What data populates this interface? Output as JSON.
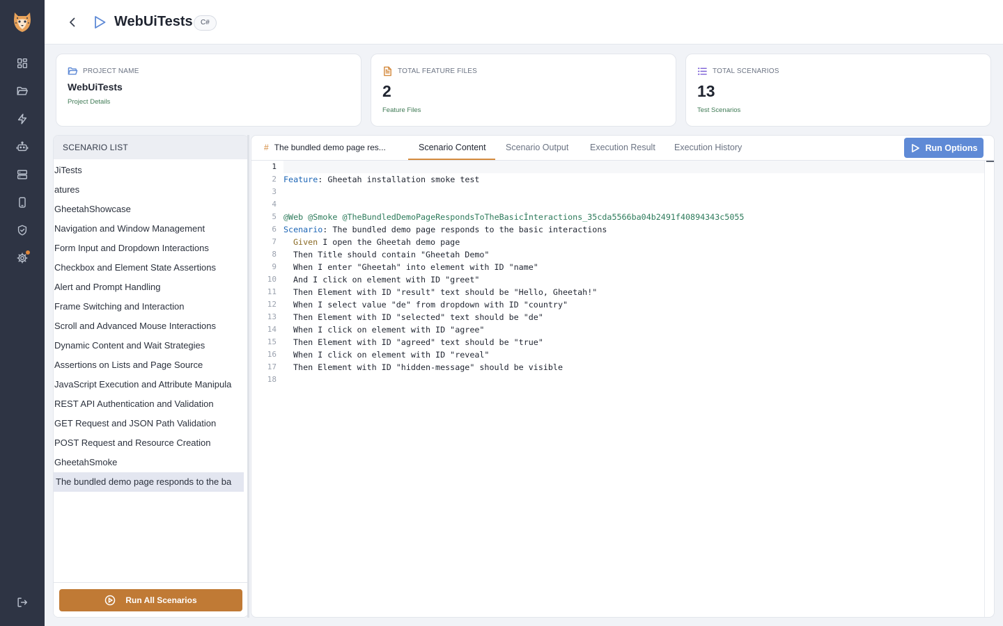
{
  "rail": {
    "items": [
      "dashboard-icon",
      "folder-icon",
      "lightning-icon",
      "robot-icon",
      "server-icon",
      "mobile-icon",
      "shield-icon",
      "gear-icon"
    ],
    "bottom": "logout-icon"
  },
  "header": {
    "title": "WebUiTests",
    "lang_badge": "C#"
  },
  "cards": {
    "project": {
      "label": "PROJECT NAME",
      "value": "WebUiTests",
      "sub": "Project Details"
    },
    "features": {
      "label": "TOTAL FEATURE FILES",
      "value": "2",
      "sub": "Feature Files"
    },
    "scenarios": {
      "label": "TOTAL SCENARIOS",
      "value": "13",
      "sub": "Test Scenarios"
    }
  },
  "scenario_list": {
    "header": "SCENARIO LIST",
    "items": [
      "JiTests",
      "atures",
      "GheetahShowcase",
      "Navigation and Window Management",
      "Form Input and Dropdown Interactions",
      "Checkbox and Element State Assertions",
      "Alert and Prompt Handling",
      "Frame Switching and Interaction",
      "Scroll and Advanced Mouse Interactions",
      "Dynamic Content and Wait Strategies",
      "Assertions on Lists and Page Source",
      "JavaScript Execution and Attribute Manipula",
      "REST API Authentication and Validation",
      "GET Request and JSON Path Validation",
      "POST Request and Resource Creation",
      "GheetahSmoke",
      "The bundled demo page responds to the ba"
    ],
    "run_all_label": "Run All Scenarios"
  },
  "editor": {
    "file_tab": "The bundled demo page res...",
    "tabs": [
      "Scenario Content",
      "Scenario Output",
      "Execution Result",
      "Execution History"
    ],
    "active_tab": "Scenario Content",
    "run_options_label": "Run Options",
    "code": {
      "line_numbers": [
        "1",
        "2",
        "3",
        "4",
        "5",
        "6",
        "7",
        "8",
        "9",
        "10",
        "11",
        "12",
        "13",
        "14",
        "15",
        "16",
        "17",
        "18"
      ],
      "feature_kw": "Feature",
      "feature_text": ": Gheetah installation smoke test",
      "tags_text": "@Web @Smoke @TheBundledDemoPageRespondsToTheBasicİnteractions_35cda5566ba04b2491f40894343c",
      "tags_suffix": "5055",
      "scenario_kw": "Scenario",
      "scenario_text": ": The bundled demo page responds to the basic interactions",
      "given_kw": "Given",
      "given_text": " I open the Gheetah demo page",
      "steps": [
        "Then Title should contain \"Gheetah Demo\"",
        "When I enter \"Gheetah\" into element with ID \"name\"",
        "And I click on element with ID \"greet\"",
        "Then Element with ID \"result\" text should be \"Hello, Gheetah!\"",
        "When I select value \"de\" from dropdown with ID \"country\"",
        "Then Element with ID \"selected\" text should be \"de\"",
        "When I click on element with ID \"agree\"",
        "Then Element with ID \"agreed\" text should be \"true\"",
        "When I click on element with ID \"reveal\"",
        "Then Element with ID \"hidden-message\" should be visible"
      ]
    }
  }
}
